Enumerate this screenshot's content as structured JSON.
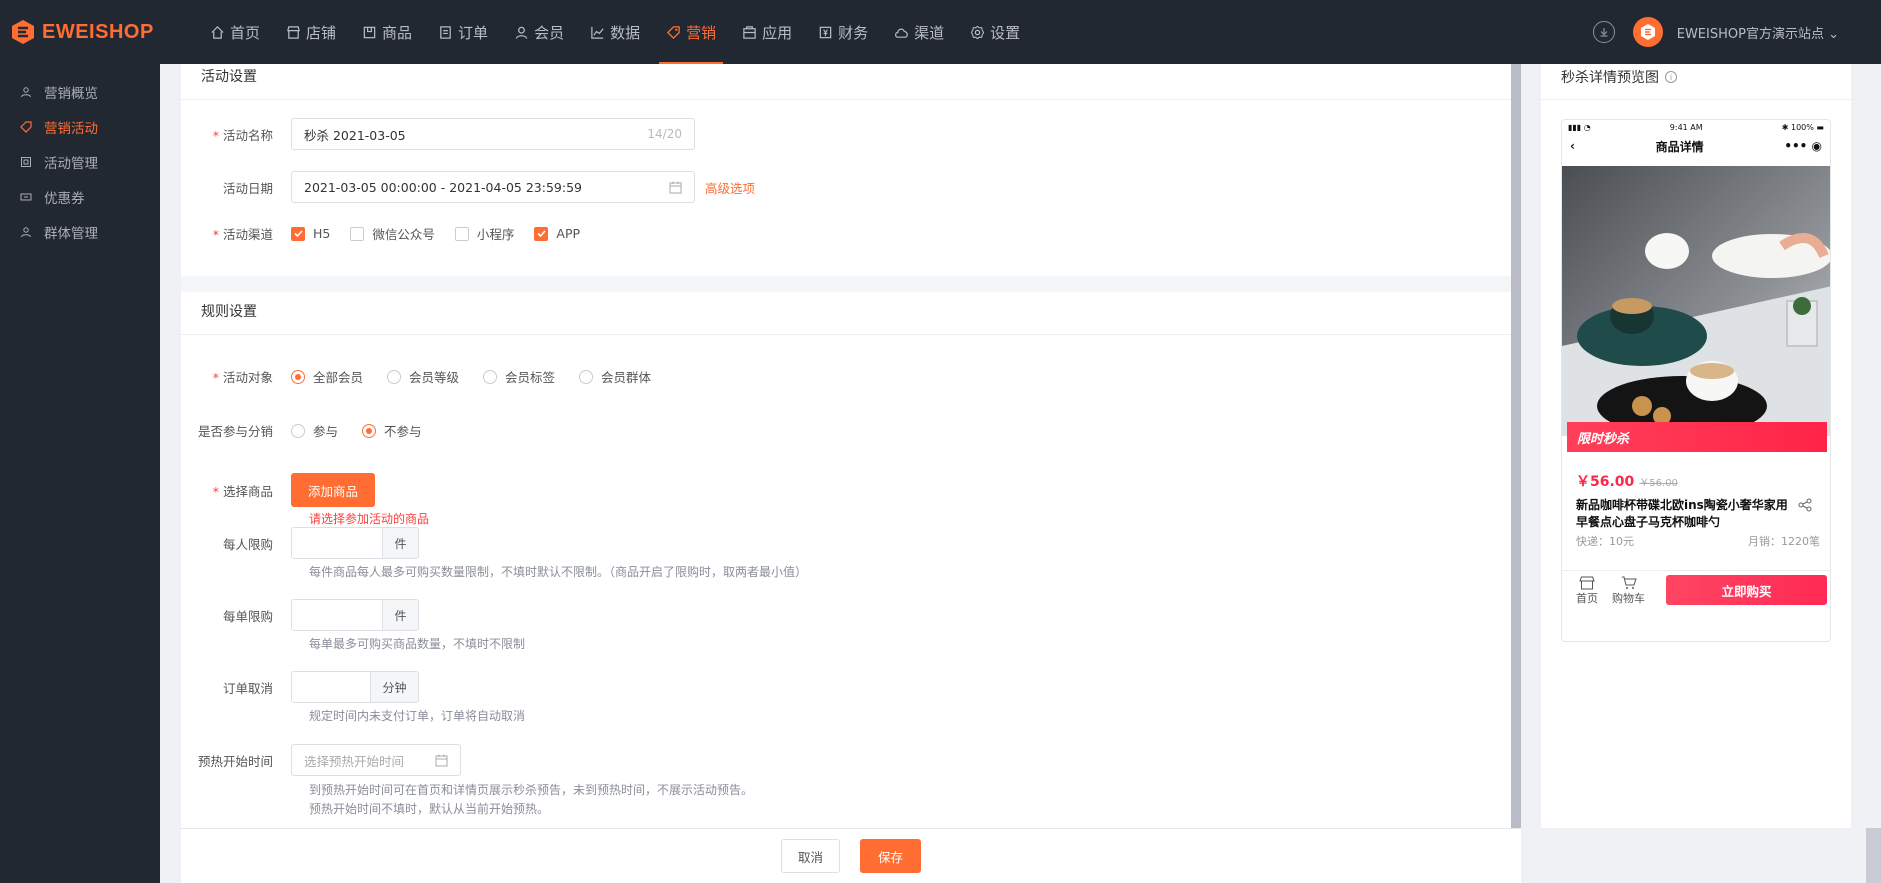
{
  "brand": {
    "name": "EWEISHOP",
    "accent": "#ff6d32"
  },
  "nav": [
    {
      "label": "首页",
      "icon": "home-icon"
    },
    {
      "label": "店铺",
      "icon": "store-icon"
    },
    {
      "label": "商品",
      "icon": "goods-icon"
    },
    {
      "label": "订单",
      "icon": "order-icon"
    },
    {
      "label": "会员",
      "icon": "user-icon"
    },
    {
      "label": "数据",
      "icon": "chart-icon"
    },
    {
      "label": "营销",
      "icon": "tag-icon",
      "active": true
    },
    {
      "label": "应用",
      "icon": "apps-icon"
    },
    {
      "label": "财务",
      "icon": "finance-icon"
    },
    {
      "label": "渠道",
      "icon": "channel-icon"
    },
    {
      "label": "设置",
      "icon": "gear-icon"
    }
  ],
  "header": {
    "site_name": "EWEISHOP官方演示站点"
  },
  "sidebar": {
    "items": [
      {
        "label": "营销概览"
      },
      {
        "label": "营销活动",
        "active": true
      },
      {
        "label": "活动管理"
      },
      {
        "label": "优惠券"
      },
      {
        "label": "群体管理"
      }
    ]
  },
  "activity": {
    "title": "活动设置",
    "name_label": "活动名称",
    "name_value": "秒杀  2021-03-05",
    "name_counter": "14/20",
    "date_label": "活动日期",
    "date_value": "2021-03-05 00:00:00 - 2021-04-05 23:59:59",
    "advanced_link": "高级选项",
    "channel_label": "活动渠道",
    "channels": [
      {
        "label": "H5",
        "checked": true
      },
      {
        "label": "微信公众号",
        "checked": false
      },
      {
        "label": "小程序",
        "checked": false
      },
      {
        "label": "APP",
        "checked": true
      }
    ]
  },
  "rules": {
    "title": "规则设置",
    "target_label": "活动对象",
    "targets": [
      {
        "label": "全部会员",
        "selected": true
      },
      {
        "label": "会员等级",
        "selected": false
      },
      {
        "label": "会员标签",
        "selected": false
      },
      {
        "label": "会员群体",
        "selected": false
      }
    ],
    "distribution_label": "是否参与分销",
    "distribution": [
      {
        "label": "参与",
        "selected": false
      },
      {
        "label": "不参与",
        "selected": true
      }
    ],
    "goods_label": "选择商品",
    "add_goods_button": "添加商品",
    "goods_error": "请选择参加活动的商品",
    "per_person_label": "每人限购",
    "per_person_unit": "件",
    "per_person_hint": "每件商品每人最多可购买数量限制，不填时默认不限制。（商品开启了限购时，取两者最小值）",
    "per_order_label": "每单限购",
    "per_order_unit": "件",
    "per_order_hint": "每单最多可购买商品数量，不填时不限制",
    "cancel_label": "订单取消",
    "cancel_unit": "分钟",
    "cancel_hint": "规定时间内未支付订单，订单将自动取消",
    "preheat_label": "预热开始时间",
    "preheat_placeholder": "选择预热开始时间",
    "preheat_hint_1": "到预热开始时间可在首页和详情页展示秒杀预告，未到预热时间，不展示活动预告。",
    "preheat_hint_2": "预热开始时间不填时，默认从当前开始预热。"
  },
  "footer": {
    "cancel": "取消",
    "save": "保存"
  },
  "preview": {
    "title": "秒杀详情预览图",
    "status_time": "9:41 AM",
    "status_battery": "100%",
    "page_title": "商品详情",
    "flash_label": "限时秒杀",
    "price_now": "￥56.00",
    "price_old": "￥56.00",
    "product_name": "新品咖啡杯带碟北欧ins陶瓷小奢华家用早餐点心盘子马克杯咖啡勺",
    "shipping": "快递：10元",
    "monthly_sales": "月销：1220笔",
    "tab_home": "首页",
    "tab_cart": "购物车",
    "buy_button": "立即购买"
  }
}
